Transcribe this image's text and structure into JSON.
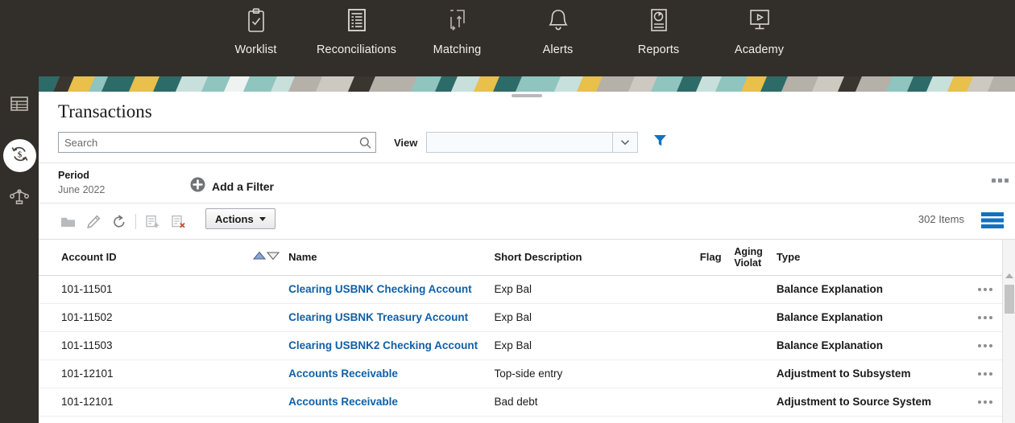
{
  "topnav": {
    "items": [
      {
        "label": "Worklist",
        "icon": "clipboard-check-icon"
      },
      {
        "label": "Reconciliations",
        "icon": "document-lines-icon"
      },
      {
        "label": "Matching",
        "icon": "match-arrows-icon"
      },
      {
        "label": "Alerts",
        "icon": "bell-icon"
      },
      {
        "label": "Reports",
        "icon": "report-chart-icon"
      },
      {
        "label": "Academy",
        "icon": "monitor-play-icon"
      }
    ]
  },
  "sidebar": {
    "items": [
      {
        "name": "table-view-icon",
        "selected": false
      },
      {
        "name": "transactions-icon",
        "selected": true
      },
      {
        "name": "balance-scale-icon",
        "selected": false
      }
    ]
  },
  "page": {
    "title": "Transactions"
  },
  "search": {
    "placeholder": "Search",
    "value": "",
    "icon": "search-icon"
  },
  "view": {
    "label": "View",
    "value": "",
    "chevron_icon": "chevron-down-icon",
    "filter_icon": "funnel-icon"
  },
  "filters": {
    "period": {
      "key": "Period",
      "value": "June 2022"
    },
    "add_filter_label": "Add a Filter",
    "add_filter_icon": "plus-circle-icon",
    "overflow_icon": "overflow-menu-icon"
  },
  "toolbar": {
    "icons": [
      {
        "name": "open-folder-icon"
      },
      {
        "name": "edit-pencil-icon"
      },
      {
        "name": "refresh-icon"
      },
      {
        "name": "add-row-icon"
      },
      {
        "name": "delete-row-icon"
      }
    ],
    "actions_label": "Actions",
    "items_count": "302 Items",
    "listview_icon": "list-view-icon"
  },
  "table": {
    "columns": [
      "Account ID",
      "Name",
      "Short Description",
      "Flag",
      "Aging Violat",
      "Type"
    ],
    "aging_header_line1": "Aging",
    "aging_header_line2": "Violat",
    "sort": {
      "active": "asc",
      "asc_icon": "sort-ascending-icon",
      "desc_icon": "sort-descending-icon"
    },
    "rows": [
      {
        "account_id": "101-11501",
        "name": "Clearing USBNK Checking Account",
        "short_description": "Exp Bal",
        "flag": "",
        "aging_violation": "",
        "type": "Balance Explanation"
      },
      {
        "account_id": "101-11502",
        "name": "Clearing USBNK Treasury Account",
        "short_description": "Exp Bal",
        "flag": "",
        "aging_violation": "",
        "type": "Balance Explanation"
      },
      {
        "account_id": "101-11503",
        "name": "Clearing USBNK2 Checking Account",
        "short_description": "Exp Bal",
        "flag": "",
        "aging_violation": "",
        "type": "Balance Explanation"
      },
      {
        "account_id": "101-12101",
        "name": "Accounts Receivable",
        "short_description": "Top-side entry",
        "flag": "",
        "aging_violation": "",
        "type": "Adjustment to Subsystem"
      },
      {
        "account_id": "101-12101",
        "name": "Accounts Receivable",
        "short_description": "Bad debt",
        "flag": "",
        "aging_violation": "",
        "type": "Adjustment to Source System"
      }
    ]
  },
  "colors": {
    "nav_background": "#322e2a",
    "link": "#1060a8",
    "accent_blue": "#0a72c4",
    "banner_teal": "#2d6b68",
    "banner_light_teal": "#8fc4bf",
    "banner_yellow": "#e8c04a",
    "banner_mint": "#c8e0dc",
    "banner_gray": "#b5b0a8"
  }
}
